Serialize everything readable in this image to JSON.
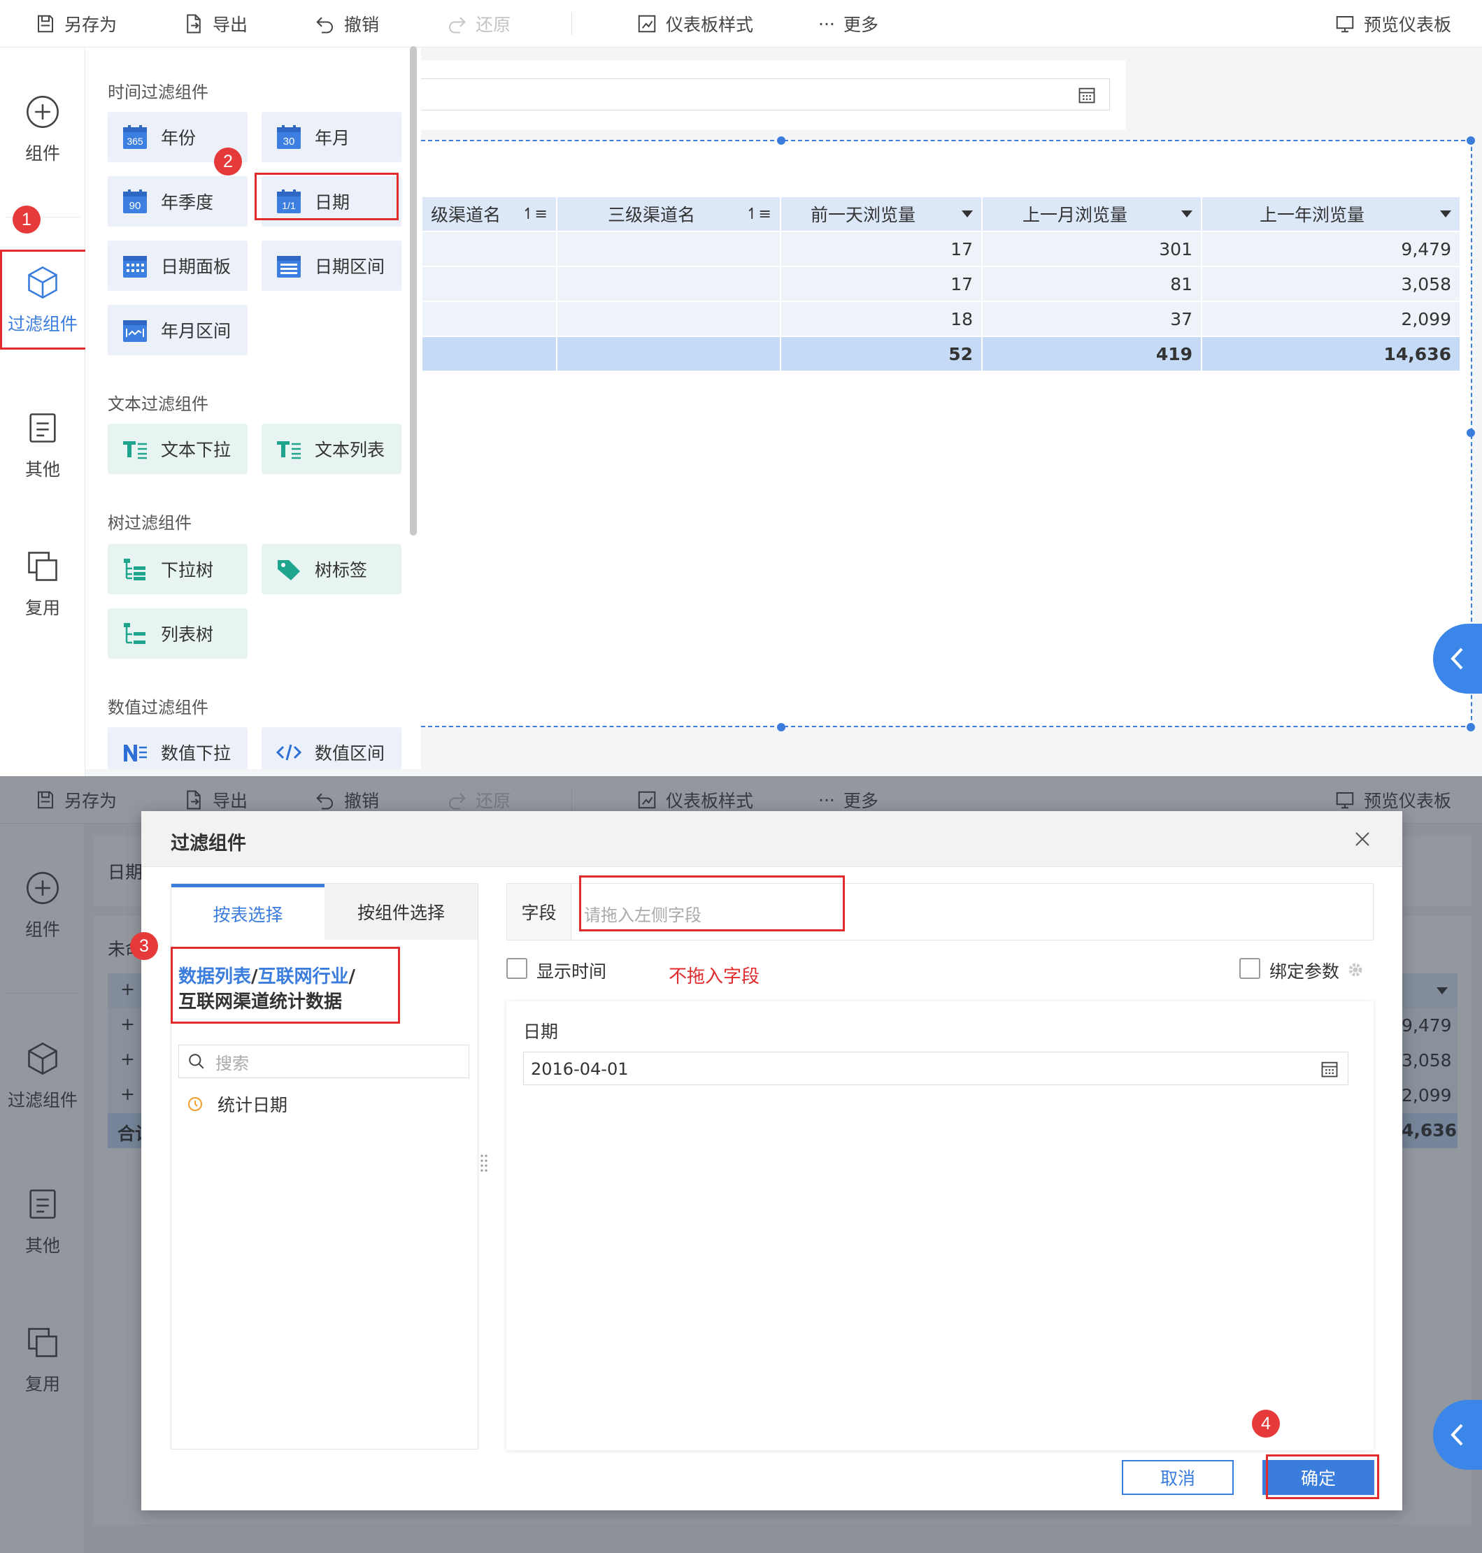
{
  "toolbar": {
    "save_as": "另存为",
    "export": "导出",
    "undo": "撤销",
    "redo": "还原",
    "dashboard_style": "仪表板样式",
    "more": "更多",
    "preview": "预览仪表板"
  },
  "sidebar": {
    "component": "组件",
    "filter": "过滤组件",
    "other": "其他",
    "reuse": "复用"
  },
  "panel": {
    "time_title": "时间过滤组件",
    "year": "年份",
    "year_month": "年月",
    "year_quarter": "年季度",
    "date": "日期",
    "date_panel": "日期面板",
    "date_range": "日期区间",
    "year_month_range": "年月区间",
    "icon_year": "365",
    "icon_month": "30",
    "icon_quarter": "90",
    "icon_date": "1/1",
    "text_title": "文本过滤组件",
    "text_dropdown": "文本下拉",
    "text_list": "文本列表",
    "tree_title": "树过滤组件",
    "dropdown_tree": "下拉树",
    "tree_tag": "树标签",
    "list_tree": "列表树",
    "num_title": "数值过滤组件",
    "num_dropdown": "数值下拉",
    "num_range": "数值区间"
  },
  "badges": {
    "b1": "1",
    "b2": "2",
    "b3": "3",
    "b4": "4"
  },
  "table": {
    "headers": [
      "级渠道名",
      "三级渠道名",
      "前一天浏览量",
      "上一月浏览量",
      "上一年浏览量"
    ],
    "rows": [
      [
        "17",
        "301",
        "9,479"
      ],
      [
        "17",
        "81",
        "3,058"
      ],
      [
        "18",
        "37",
        "2,099"
      ]
    ],
    "total": [
      "52",
      "419",
      "14,636"
    ]
  },
  "bg2": {
    "date_label": "日期",
    "unnamed": "未命",
    "plus": "+",
    "total": "合计",
    "vals": [
      "9,479",
      "3,058",
      "2,099",
      "4,636"
    ]
  },
  "dialog": {
    "title": "过滤组件",
    "tab_table": "按表选择",
    "tab_component": "按组件选择",
    "path_sep": "/",
    "path_1": "数据列表",
    "path_2": "互联网行业",
    "path_3": "互联网渠道统计数据",
    "search_placeholder": "搜索",
    "field_item": "统计日期",
    "field_label": "字段",
    "field_placeholder": "请拖入左侧字段",
    "show_time": "显示时间",
    "note": "不拖入字段",
    "bind_param": "绑定参数",
    "preview_label": "日期",
    "preview_value": "2016-04-01",
    "cancel": "取消",
    "ok": "确定"
  }
}
